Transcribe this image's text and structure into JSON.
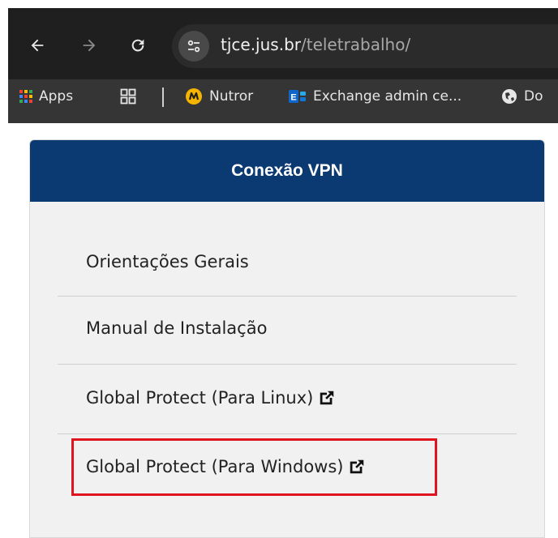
{
  "browser": {
    "nav": {
      "back_icon": "arrow-left-icon",
      "forward_icon": "arrow-right-icon",
      "reload_icon": "reload-icon"
    },
    "address": {
      "host": "tjce.jus.br",
      "path": "/teletrabalho/",
      "site_info_icon": "tune-icon"
    },
    "bookmarks": [
      {
        "label": "Apps",
        "icon": "apps-grid-icon"
      },
      {
        "label": "",
        "icon": "tab-groups-icon"
      },
      {
        "label": "Nutror",
        "icon": "nutror-logo-icon"
      },
      {
        "label": "Exchange admin ce...",
        "icon": "exchange-logo-icon"
      },
      {
        "label": "Do",
        "icon": "globe-icon"
      }
    ]
  },
  "panel": {
    "title": "Conexão VPN",
    "items": [
      {
        "label": "Orientações Gerais",
        "external": false
      },
      {
        "label": "Manual de Instalação",
        "external": false
      },
      {
        "label": "Global Protect (Para Linux)",
        "external": true
      },
      {
        "label": "Global Protect (Para Windows)",
        "external": true
      }
    ],
    "header_color": "#0b3a73",
    "highlight_color": "#e0141e"
  }
}
